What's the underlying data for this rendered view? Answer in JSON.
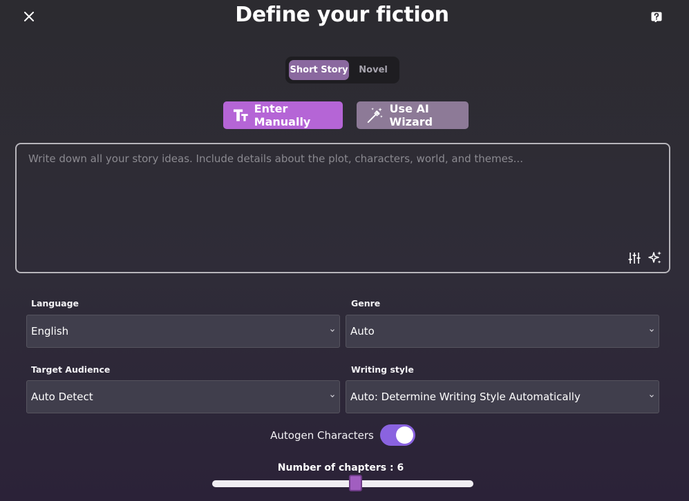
{
  "header": {
    "title": "Define your fiction",
    "close_icon": "close-icon",
    "help_icon": "help-icon"
  },
  "story_type": {
    "options": [
      "Short Story",
      "Novel"
    ],
    "selected": "Short Story"
  },
  "mode": {
    "manual_label": "Enter Manually",
    "wizard_label": "Use AI Wizard",
    "active": "Enter Manually"
  },
  "ideas": {
    "value": "",
    "placeholder": "Write down all your story ideas. Include details about the plot, characters, world, and themes..."
  },
  "fields": {
    "language": {
      "label": "Language",
      "value": "English"
    },
    "genre": {
      "label": "Genre",
      "value": "Auto"
    },
    "target_audience": {
      "label": "Target Audience",
      "value": "Auto Detect"
    },
    "writing_style": {
      "label": "Writing style",
      "value": "Auto: Determine Writing Style Automatically"
    }
  },
  "autogen": {
    "label": "Autogen Characters",
    "enabled": true
  },
  "chapters": {
    "label": "Number of chapters : 6",
    "value": 6,
    "fraction": 0.55
  },
  "colors": {
    "accent_manual": "#b565d6",
    "accent_wizard": "#8d7a97",
    "toggle_on": "#8a63e0",
    "slider_thumb": "#a15ec0"
  }
}
